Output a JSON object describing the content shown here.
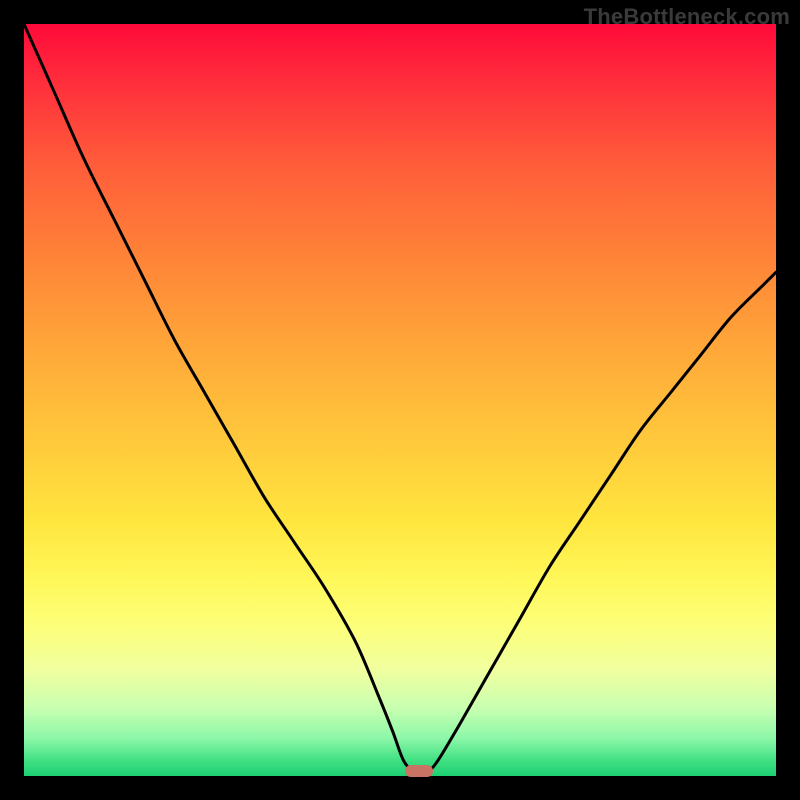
{
  "watermark": "TheBottleneck.com",
  "colors": {
    "frame": "#000000",
    "curve": "#000000",
    "marker": "#c97365"
  },
  "chart_data": {
    "type": "line",
    "title": "",
    "xlabel": "",
    "ylabel": "",
    "xlim": [
      0,
      100
    ],
    "ylim": [
      0,
      100
    ],
    "grid": false,
    "series": [
      {
        "name": "bottleneck-curve",
        "x": [
          0,
          4,
          8,
          12,
          16,
          20,
          24,
          28,
          32,
          36,
          40,
          44,
          47,
          49,
          50.5,
          52,
          53.5,
          55,
          58,
          62,
          66,
          70,
          74,
          78,
          82,
          86,
          90,
          94,
          98,
          100
        ],
        "y": [
          100,
          91,
          82,
          74,
          66,
          58,
          51,
          44,
          37,
          31,
          25,
          18,
          11,
          6,
          2,
          0.5,
          0.5,
          2,
          7,
          14,
          21,
          28,
          34,
          40,
          46,
          51,
          56,
          61,
          65,
          67
        ]
      }
    ],
    "marker": {
      "x": 52.5,
      "y": 0.6
    },
    "gradient_stops": [
      {
        "pos": 0,
        "color": "#ff0a3a"
      },
      {
        "pos": 18,
        "color": "#ff5a3a"
      },
      {
        "pos": 42,
        "color": "#ffa439"
      },
      {
        "pos": 66,
        "color": "#ffe53e"
      },
      {
        "pos": 86,
        "color": "#f0ffa0"
      },
      {
        "pos": 100,
        "color": "#1dcf74"
      }
    ]
  }
}
